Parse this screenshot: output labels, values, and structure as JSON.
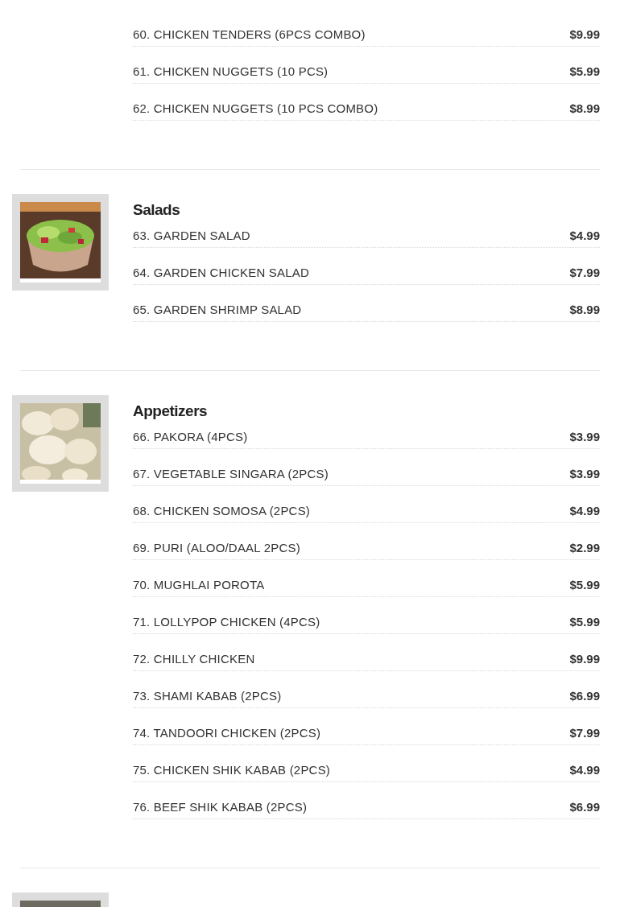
{
  "sections": [
    {
      "items": [
        {
          "name": "60. CHICKEN TENDERS (6PCS COMBO)",
          "price": "$9.99"
        },
        {
          "name": "61. CHICKEN NUGGETS (10 PCS)",
          "price": "$5.99"
        },
        {
          "name": "62. CHICKEN NUGGETS (10 PCS COMBO)",
          "price": "$8.99"
        }
      ]
    },
    {
      "title": "Salads",
      "image": {
        "kind": "picture"
      },
      "items": [
        {
          "name": "63. GARDEN SALAD",
          "price": "$4.99"
        },
        {
          "name": "64. GARDEN CHICKEN SALAD",
          "price": "$7.99"
        },
        {
          "name": "65. GARDEN SHRIMP SALAD",
          "price": "$8.99"
        }
      ]
    },
    {
      "title": "Appetizers",
      "image": {
        "kind": "picture"
      },
      "items": [
        {
          "name": "66. PAKORA (4PCS)",
          "price": "$3.99"
        },
        {
          "name": "67. VEGETABLE SINGARA (2PCS)",
          "price": "$3.99"
        },
        {
          "name": "68. CHICKEN SOMOSA (2PCS)",
          "price": "$4.99"
        },
        {
          "name": "69. PURI (ALOO/DAAL 2PCS)",
          "price": "$2.99"
        },
        {
          "name": "70. MUGHLAI POROTA",
          "price": "$5.99"
        },
        {
          "name": "71. LOLLYPOP CHICKEN (4PCS)",
          "price": "$5.99"
        },
        {
          "name": "72. CHILLY CHICKEN",
          "price": "$9.99"
        },
        {
          "name": "73. SHAMI KABAB (2PCS)",
          "price": "$6.99"
        },
        {
          "name": "74. TANDOORI CHICKEN (2PCS)",
          "price": "$7.99"
        },
        {
          "name": "75. CHICKEN SHIK KABAB (2PCS)",
          "price": "$4.99"
        },
        {
          "name": "76. BEEF SHIK KABAB (2PCS)",
          "price": "$6.99"
        }
      ]
    },
    {
      "image": {
        "kind": "picture"
      }
    }
  ]
}
